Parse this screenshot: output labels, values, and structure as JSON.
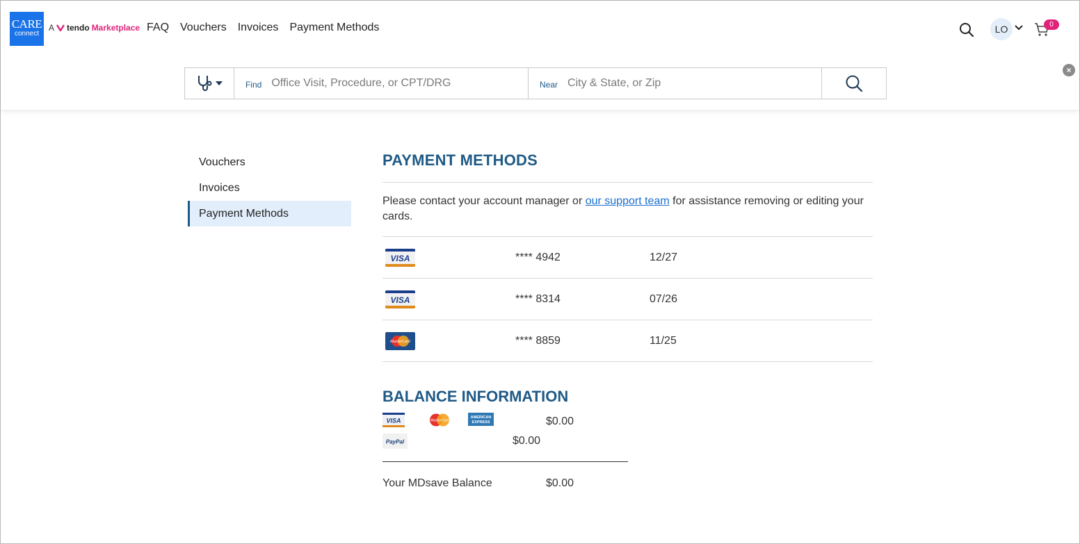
{
  "header": {
    "logo_line1": "CARE",
    "logo_line2": "connect",
    "brand_a": "A",
    "brand_tendo": "tendo",
    "brand_marketplace": "Marketplace",
    "nav": [
      "FAQ",
      "Vouchers",
      "Invoices",
      "Payment Methods"
    ],
    "user_initials": "LO",
    "cart_count": "0",
    "close_glyph": "×"
  },
  "search": {
    "find_label": "Find",
    "find_placeholder": "Office Visit, Procedure, or CPT/DRG",
    "near_label": "Near",
    "near_placeholder": "City & State, or Zip"
  },
  "sidebar": {
    "items": [
      {
        "label": "Vouchers",
        "active": false
      },
      {
        "label": "Invoices",
        "active": false
      },
      {
        "label": "Payment Methods",
        "active": true
      }
    ]
  },
  "payment_methods": {
    "title": "PAYMENT METHODS",
    "notice_before": "Please contact your account manager or ",
    "notice_link": "our support team",
    "notice_after": " for assistance removing or editing your cards.",
    "cards": [
      {
        "brand": "VISA",
        "number": "**** 4942",
        "expiry": "12/27"
      },
      {
        "brand": "VISA",
        "number": "**** 8314",
        "expiry": "07/26"
      },
      {
        "brand": "MasterCard",
        "number": "**** 8859",
        "expiry": "11/25"
      }
    ]
  },
  "balance": {
    "title": "BALANCE INFORMATION",
    "cards_amount": "$0.00",
    "paypal_amount": "$0.00",
    "total_label": "Your MDsave Balance",
    "total_amount": "$0.00",
    "mini_visa": "VISA",
    "mini_mc": "MasterCard",
    "mini_amex_line1": "AMERICAN",
    "mini_amex_line2": "EXPRESS",
    "mini_paypal": "PayPal"
  },
  "colors": {
    "brand_blue": "#1a73e8",
    "heading_blue": "#1f5a86",
    "link_blue": "#1a6fce",
    "pink": "#e0227a",
    "active_bg": "#e2eefb"
  },
  "icons": {
    "stethoscope": "stethoscope-icon",
    "search": "search-icon",
    "cart": "cart-icon",
    "chevron": "chevron-down-icon",
    "close": "close-icon"
  }
}
